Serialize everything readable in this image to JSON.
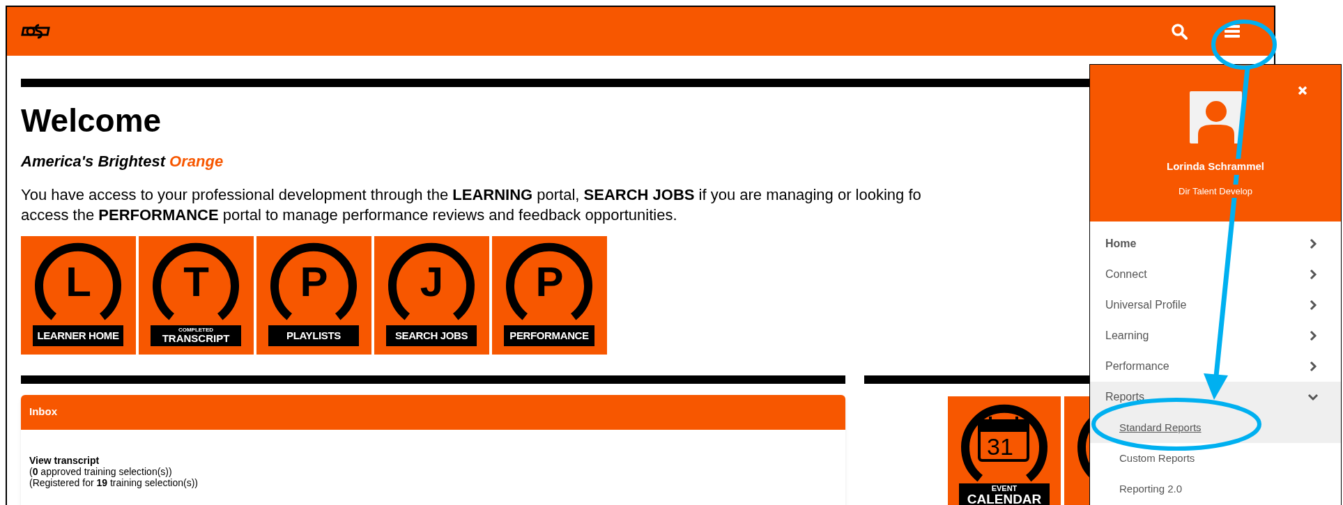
{
  "welcome": {
    "title": "Welcome",
    "tagline": "America's Brightest",
    "tagline_accent": "Orange",
    "intro_lines": [
      "You have access to your professional development through the **LEARNING** portal, **SEARCH JOBS** if you are managing or looking fo",
      "access the **PERFORMANCE** portal to manage performance reviews and feedback opportunities."
    ]
  },
  "tiles": [
    {
      "letter": "L",
      "caption": "LEARNER HOME"
    },
    {
      "letter": "T",
      "caption_small": "COMPLETED",
      "caption": "TRANSCRIPT"
    },
    {
      "letter": "P",
      "caption": "PLAYLISTS"
    },
    {
      "letter": "J",
      "caption": "SEARCH JOBS"
    },
    {
      "letter": "P",
      "caption": "PERFORMANCE"
    }
  ],
  "inbox": {
    "title": "Inbox",
    "link": "View transcript",
    "lines": [
      "(**0** approved training selection(s))",
      "(Registered for **19** training selection(s))"
    ]
  },
  "side_tiles": [
    {
      "kind": "calendar",
      "day": "31",
      "caption_small": "EVENT",
      "caption": "CALENDAR"
    },
    {
      "kind": "ring"
    }
  ],
  "menu": {
    "user": {
      "name": "Lorinda Schrammel",
      "title": "Dir Talent Develop"
    },
    "items": [
      {
        "label": "Home",
        "selected": true,
        "expanded": false
      },
      {
        "label": "Connect",
        "selected": false,
        "expanded": false
      },
      {
        "label": "Universal Profile",
        "selected": false,
        "expanded": false
      },
      {
        "label": "Learning",
        "selected": false,
        "expanded": false
      },
      {
        "label": "Performance",
        "selected": false,
        "expanded": false
      },
      {
        "label": "Reports",
        "selected": false,
        "expanded": true,
        "children": [
          {
            "label": "Standard Reports",
            "selected": true
          },
          {
            "label": "Custom Reports",
            "selected": false
          },
          {
            "label": "Reporting 2.0",
            "selected": false
          }
        ]
      }
    ]
  }
}
